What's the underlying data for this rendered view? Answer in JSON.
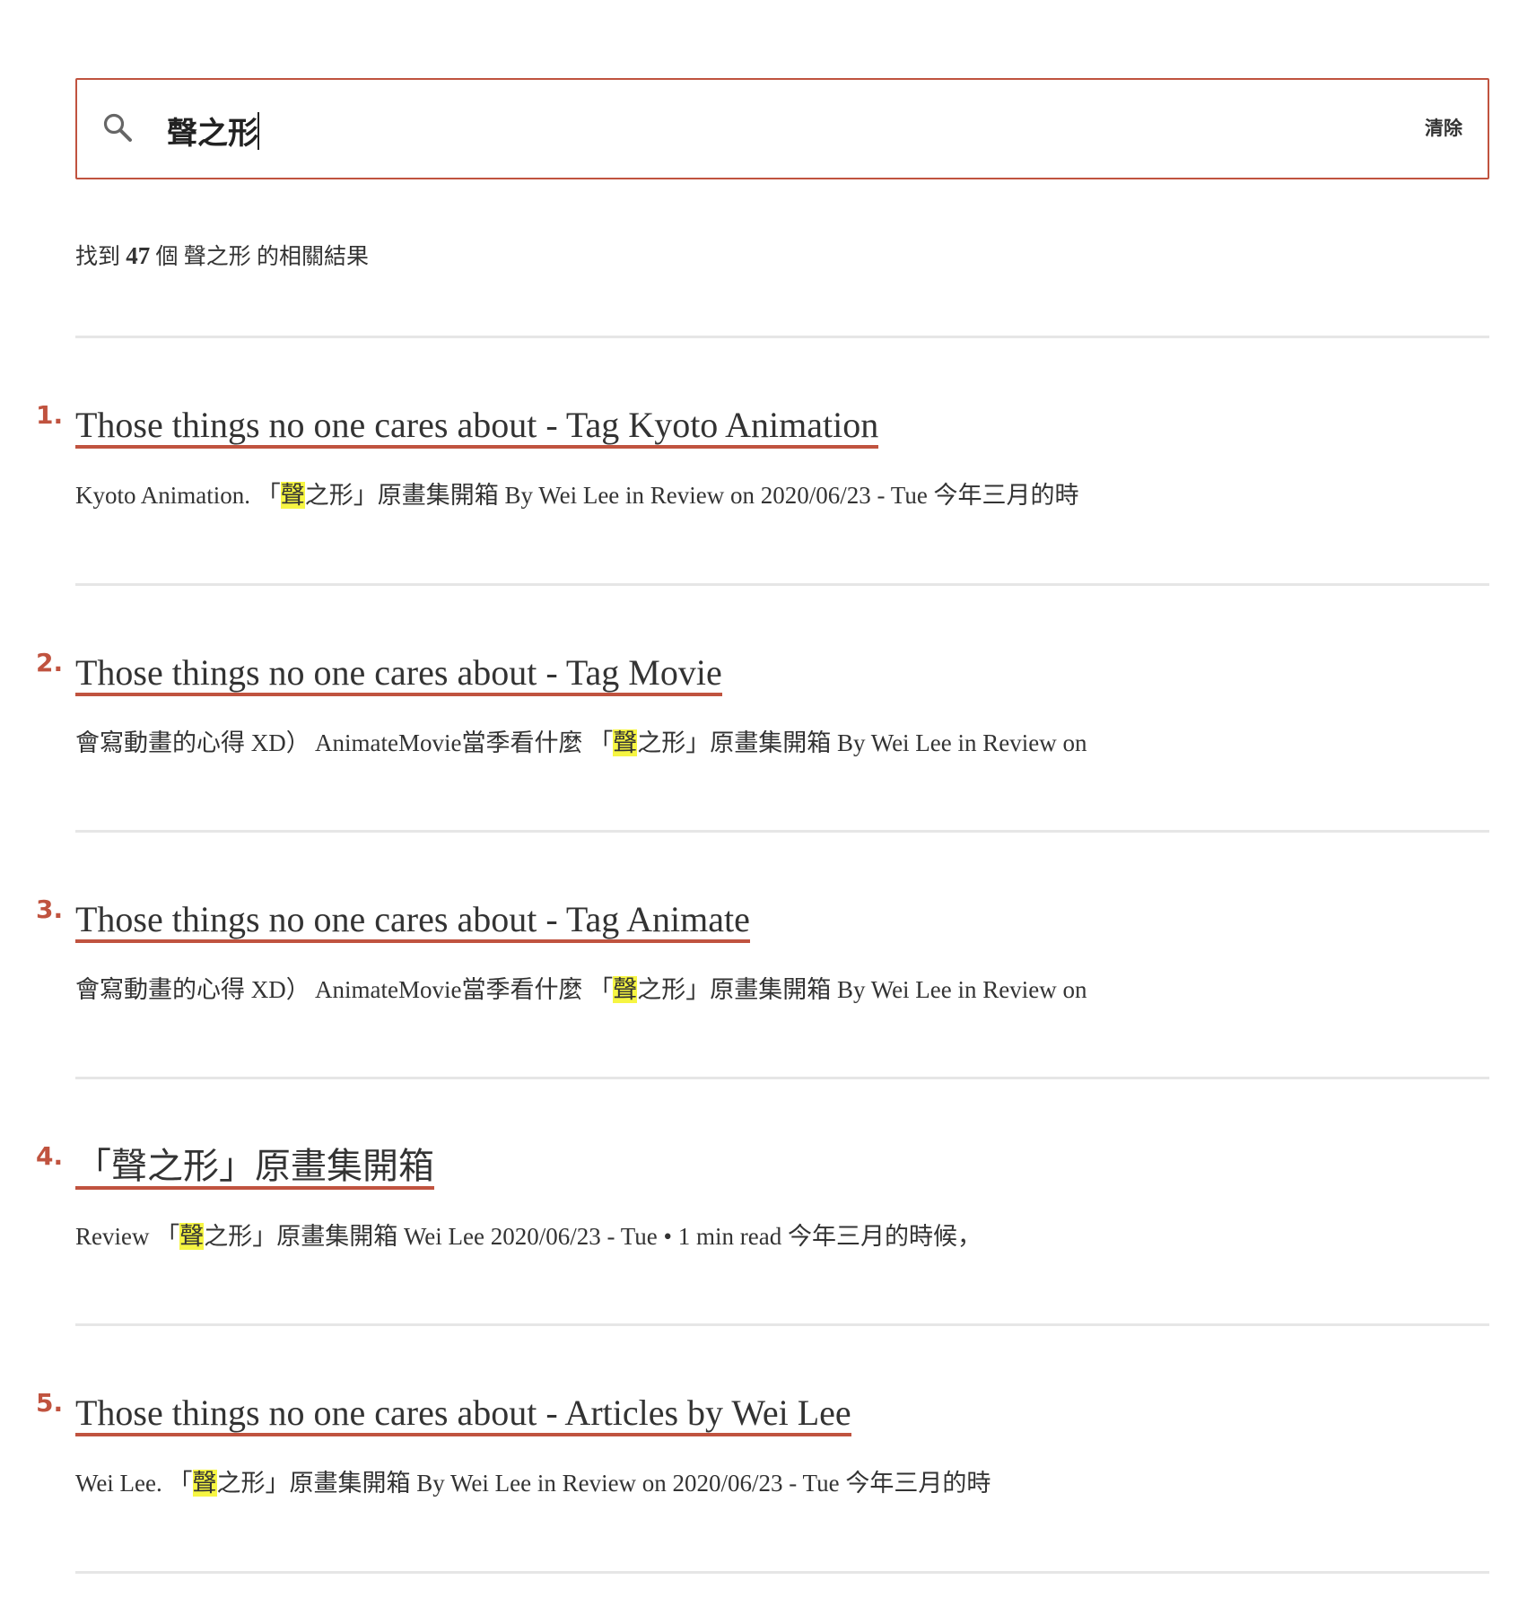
{
  "search": {
    "value": "聲之形",
    "clear_label": "清除"
  },
  "summary": {
    "prefix": "找到",
    "count": "47",
    "middle": "個",
    "term": "聲之形",
    "suffix": "的相關結果"
  },
  "results": [
    {
      "number": "1.",
      "title": "Those things no one cares about - Tag Kyoto Animation",
      "snippet_before": "Kyoto Animation. 「",
      "highlight": "聲",
      "snippet_after": "之形」原畫集開箱 By Wei Lee in Review on 2020/06/23 - Tue 今年三月的時"
    },
    {
      "number": "2.",
      "title": "Those things no one cares about - Tag Movie",
      "snippet_before": "會寫動畫的心得 XD） AnimateMovie當季看什麼 「",
      "highlight": "聲",
      "snippet_after": "之形」原畫集開箱 By Wei Lee in Review on"
    },
    {
      "number": "3.",
      "title": "Those things no one cares about - Tag Animate",
      "snippet_before": "會寫動畫的心得 XD） AnimateMovie當季看什麼 「",
      "highlight": "聲",
      "snippet_after": "之形」原畫集開箱 By Wei Lee in Review on"
    },
    {
      "number": "4.",
      "title": "「聲之形」原畫集開箱",
      "snippet_before": "Review 「",
      "highlight": "聲",
      "snippet_after": "之形」原畫集開箱 Wei Lee 2020/06/23 - Tue • 1 min read 今年三月的時候，"
    },
    {
      "number": "5.",
      "title": "Those things no one cares about - Articles by Wei Lee",
      "snippet_before": "Wei Lee. 「",
      "highlight": "聲",
      "snippet_after": "之形」原畫集開箱 By Wei Lee in Review on 2020/06/23 - Tue 今年三月的時"
    }
  ],
  "colors": {
    "accent": "#c0533f",
    "highlight": "#f6f542",
    "divider": "#e6e6e6",
    "text": "#333333"
  },
  "icons": {
    "search": "magnifier"
  }
}
